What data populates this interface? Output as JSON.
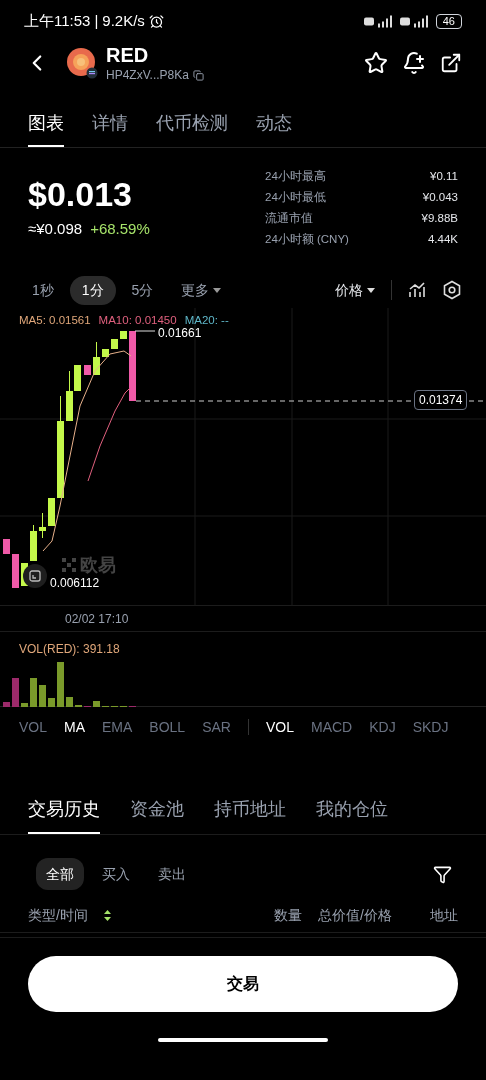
{
  "status_bar": {
    "time": "上午11:53",
    "separator": "|",
    "speed": "9.2K/s",
    "battery": "46"
  },
  "header": {
    "symbol": "RED",
    "address": "HP4ZxV...P8Ka"
  },
  "tabs": [
    {
      "label": "图表",
      "selected": true
    },
    {
      "label": "详情",
      "selected": false
    },
    {
      "label": "代币检测",
      "selected": false
    },
    {
      "label": "动态",
      "selected": false
    }
  ],
  "price": {
    "usd": "$0.013",
    "cny": "≈¥0.098",
    "change": "+68.59%"
  },
  "stats": [
    {
      "label": "24小时最高",
      "value": "¥0.11"
    },
    {
      "label": "24小时最低",
      "value": "¥0.043"
    },
    {
      "label": "流通市值",
      "value": "¥9.88B"
    },
    {
      "label": "24小时额 (CNY)",
      "value": "4.44K"
    }
  ],
  "intervals": [
    {
      "label": "1秒",
      "selected": false,
      "kind": "option"
    },
    {
      "label": "1分",
      "selected": true,
      "kind": "option"
    },
    {
      "label": "5分",
      "selected": false,
      "kind": "option"
    },
    {
      "label": "更多",
      "selected": false,
      "kind": "dropdown"
    }
  ],
  "price_mode": {
    "label": "价格"
  },
  "chart": {
    "ma_legend": [
      {
        "label": "MA5: 0.01561",
        "color": "#e0a77a"
      },
      {
        "label": "MA10: 0.01450",
        "color": "#e0607e"
      },
      {
        "label": "MA20: --",
        "color": "#5fb7c9"
      }
    ],
    "high_label": "0.01661",
    "low_label": "0.006112",
    "last_price": "0.01374",
    "time_label": "02/02 17:10",
    "watermark": "欧易"
  },
  "volume": {
    "label": "VOL(RED): 391.18"
  },
  "indicators_main": [
    {
      "label": "VOL",
      "selected": false
    },
    {
      "label": "MA",
      "selected": true
    },
    {
      "label": "EMA",
      "selected": false
    },
    {
      "label": "BOLL",
      "selected": false
    },
    {
      "label": "SAR",
      "selected": false
    }
  ],
  "indicators_sub": [
    {
      "label": "VOL",
      "selected": true
    },
    {
      "label": "MACD",
      "selected": false
    },
    {
      "label": "KDJ",
      "selected": false
    },
    {
      "label": "SKDJ",
      "selected": false
    }
  ],
  "trade_tabs": [
    {
      "label": "交易历史",
      "selected": true
    },
    {
      "label": "资金池",
      "selected": false
    },
    {
      "label": "持币地址",
      "selected": false
    },
    {
      "label": "我的仓位",
      "selected": false
    }
  ],
  "filters": [
    {
      "label": "全部",
      "selected": true
    },
    {
      "label": "买入",
      "selected": false
    },
    {
      "label": "卖出",
      "selected": false
    }
  ],
  "columns": [
    "类型/时间",
    "数量",
    "总价值/价格",
    "地址"
  ],
  "trade_button": "交易"
}
